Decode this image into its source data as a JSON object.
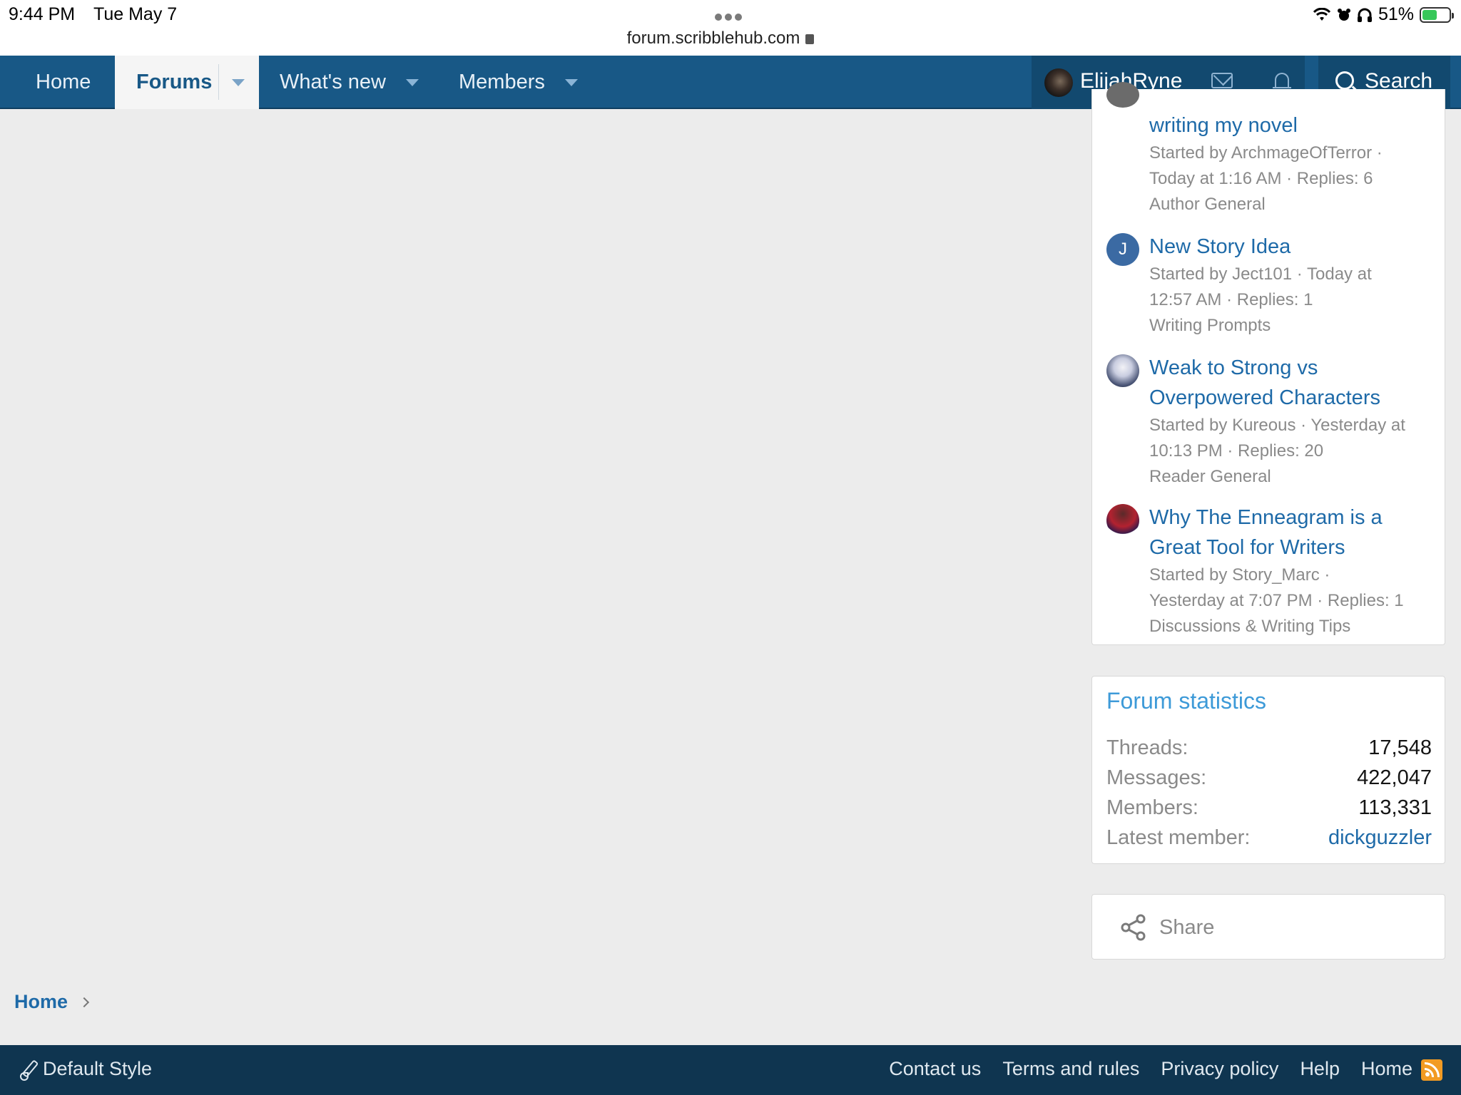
{
  "status_bar": {
    "time": "9:44 PM",
    "date": "Tue May 7",
    "url": "forum.scribblehub.com",
    "battery": "51%"
  },
  "nav": {
    "home": "Home",
    "forums": "Forums",
    "whats_new": "What's new",
    "members": "Members",
    "username": "ElijahRyne",
    "search": "Search"
  },
  "threads": [
    {
      "title": "writing my novel",
      "meta1": "Started by ArchmageOfTerror ·",
      "meta2": "Today at 1:16 AM · Replies: 6",
      "forum": "Author General"
    },
    {
      "avatar_letter": "J",
      "title": "New Story Idea",
      "meta1": "Started by Ject101 · Today at",
      "meta2": "12:57 AM · Replies: 1",
      "forum": "Writing Prompts"
    },
    {
      "title1": "Weak to Strong vs",
      "title2": "Overpowered Characters",
      "meta1": "Started by Kureous · Yesterday at",
      "meta2": "10:13 PM · Replies: 20",
      "forum": "Reader General"
    },
    {
      "title1": "Why The Enneagram is a",
      "title2": "Great Tool for Writers",
      "meta1": "Started by Story_Marc ·",
      "meta2": "Yesterday at 7:07 PM · Replies: 1",
      "forum": "Discussions & Writing Tips"
    }
  ],
  "stats": {
    "title": "Forum statistics",
    "rows": [
      {
        "label": "Threads:",
        "value": "17,548"
      },
      {
        "label": "Messages:",
        "value": "422,047"
      },
      {
        "label": "Members:",
        "value": "113,331"
      },
      {
        "label": "Latest member:",
        "value": "dickguzzler"
      }
    ]
  },
  "share": {
    "label": "Share"
  },
  "breadcrumb": {
    "home": "Home"
  },
  "footer": {
    "style": "Default Style",
    "links": [
      "Contact us",
      "Terms and rules",
      "Privacy policy",
      "Help",
      "Home"
    ]
  },
  "colors": {
    "nav_bg": "#185886",
    "footer_bg": "#0f3550",
    "link": "#1e6aa8",
    "stats_title": "#3d9ad8",
    "rss": "#f29b23"
  },
  "icons": [
    "lock-icon",
    "wifi-icon",
    "alarm-icon",
    "headphones-icon",
    "battery-icon",
    "chevron-down-icon",
    "mail-icon",
    "bell-icon",
    "search-icon",
    "share-icon",
    "chevron-right-icon",
    "brush-icon",
    "rss-icon"
  ]
}
